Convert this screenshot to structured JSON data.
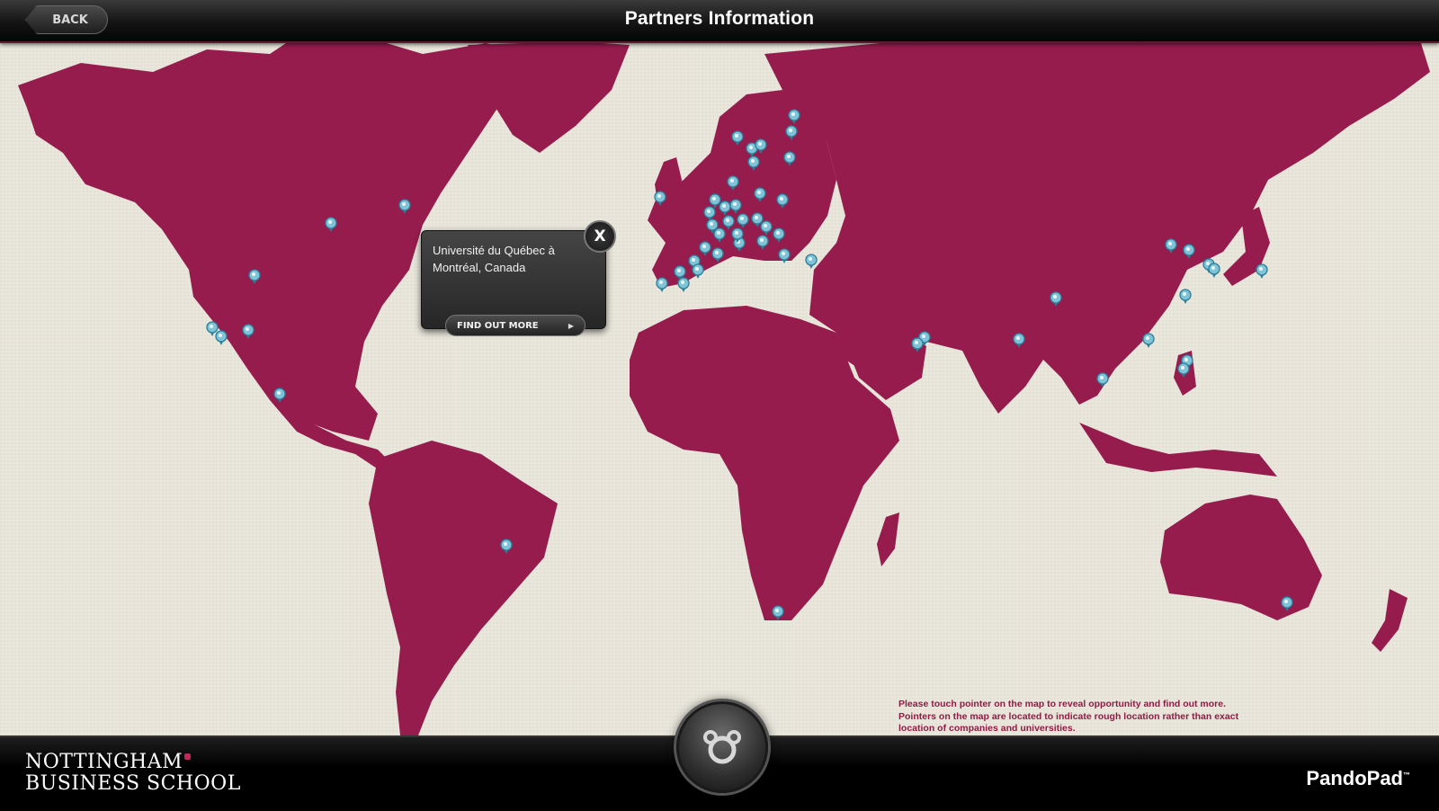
{
  "header": {
    "back_label": "BACK",
    "title": "Partners Information"
  },
  "popup": {
    "partner_name": "Université du Québec à Montréal, Canada",
    "find_out_more_label": "FIND OUT MORE",
    "close_label": "X"
  },
  "instructions": {
    "line1": "Please touch pointer on the map to reveal opportunity and find out more.",
    "line2": "Pointers on the map are located to indicate rough location rather than exact location of companies and universities."
  },
  "footer": {
    "school_line1": "NOTTINGHAM",
    "school_line2": "BUSINESS SCHOOL",
    "brand": "PandoPad",
    "brand_mark": "™"
  },
  "colors": {
    "land": "#961c4e",
    "ocean": "#ebe8dd",
    "pin": "#7ec3d8",
    "text_accent": "#8e1c45"
  },
  "icons": {
    "home": "pando-bear-icon",
    "pin": "map-pin-icon",
    "close": "close-icon"
  }
}
